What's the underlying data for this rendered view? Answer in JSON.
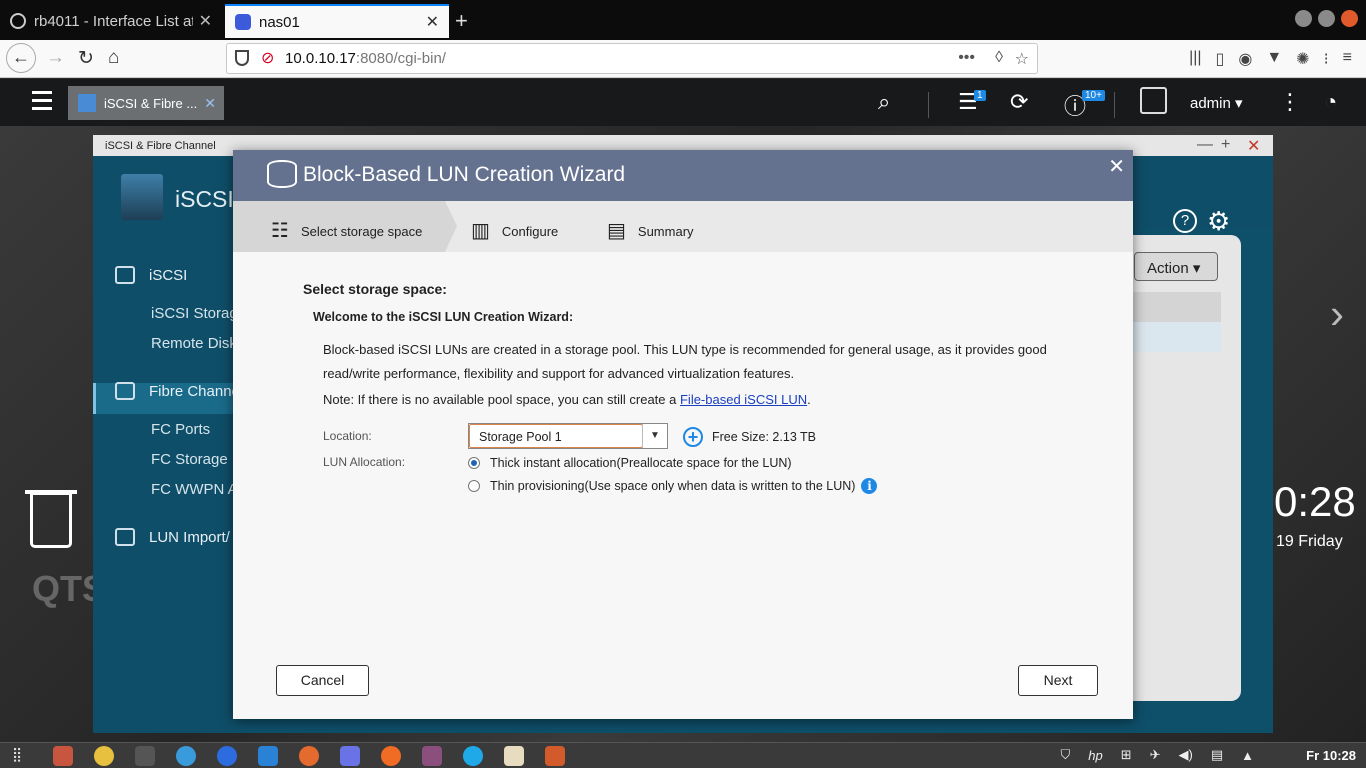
{
  "browser": {
    "tabs": [
      {
        "title": "rb4011 - Interface List at",
        "active": false
      },
      {
        "title": "nas01",
        "active": true
      }
    ],
    "url_host": "10.0.10.17",
    "url_rest": ":8080/cgi-bin/"
  },
  "qts": {
    "app_tab_label": "iSCSI & Fibre ...",
    "notification_badge": "1",
    "info_badge": "10+",
    "user": "admin",
    "clock_time": "0:28",
    "clock_date": "19 Friday",
    "logo": "QTS"
  },
  "app_window": {
    "title": "iSCSI & Fibre Channel",
    "app_name": "iSCSI",
    "sidebar": [
      {
        "label": "iSCSI",
        "type": "section"
      },
      {
        "label": "iSCSI Storage",
        "type": "item",
        "active": true
      },
      {
        "label": "Remote Disk",
        "type": "item"
      },
      {
        "label": "Fibre Channel",
        "type": "section"
      },
      {
        "label": "FC Ports",
        "type": "item"
      },
      {
        "label": "FC Storage",
        "type": "item"
      },
      {
        "label": "FC WWPN Al",
        "type": "item"
      },
      {
        "label": "LUN Import/",
        "type": "section"
      }
    ],
    "action_label": "Action"
  },
  "wizard": {
    "title": "Block-Based LUN Creation Wizard",
    "steps": [
      {
        "label": "Select storage space",
        "active": true
      },
      {
        "label": "Configure",
        "active": false
      },
      {
        "label": "Summary",
        "active": false
      }
    ],
    "heading": "Select storage space:",
    "subheading": "Welcome to the iSCSI LUN Creation Wizard:",
    "description": "Block-based iSCSI LUNs are created in a storage pool. This LUN type is recommended for general usage, as it provides good read/write performance, flexibility and support for advanced virtualization features.",
    "note_prefix": "Note: If there is no available pool space, you can still create a ",
    "note_link": "File-based iSCSI LUN",
    "note_suffix": ".",
    "location_label": "Location:",
    "location_value": "Storage Pool 1",
    "free_size": "Free Size: 2.13 TB",
    "allocation_label": "LUN Allocation:",
    "options": [
      {
        "label": "Thick instant allocation(Preallocate space for the LUN)",
        "selected": true
      },
      {
        "label": "Thin provisioning(Use space only when data is written to the LUN)",
        "selected": false
      }
    ],
    "cancel_label": "Cancel",
    "next_label": "Next"
  },
  "taskbar": {
    "clock": "Fr 10:28"
  },
  "colors": {
    "wizard_header": "#65728f",
    "app_bg": "#0f4e68",
    "accent": "#1e88e5"
  }
}
